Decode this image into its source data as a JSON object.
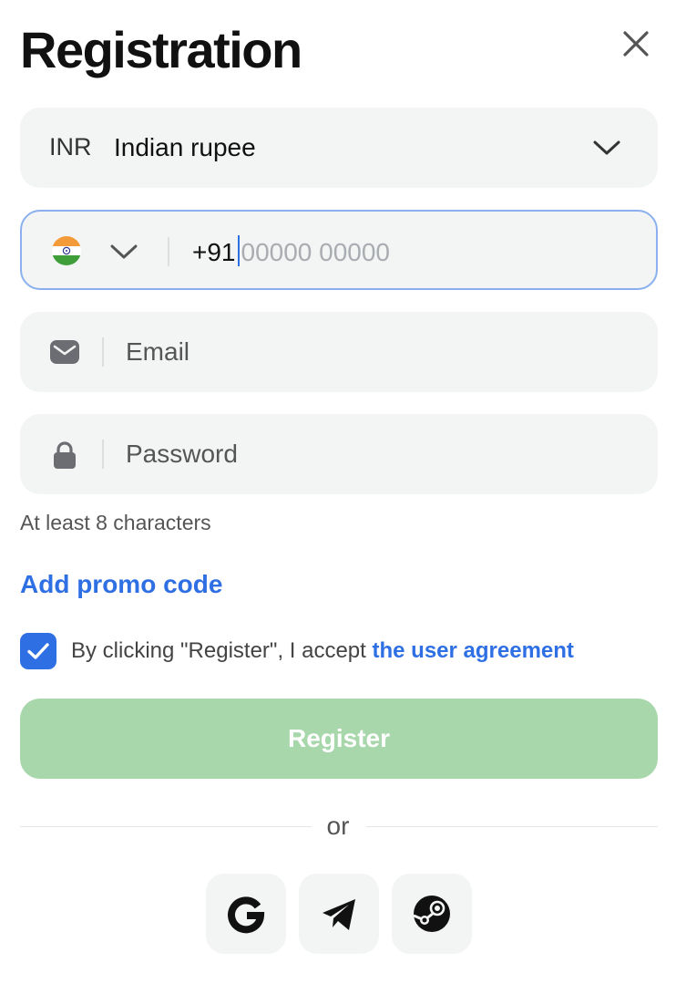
{
  "header": {
    "title": "Registration",
    "close_icon": "close-icon"
  },
  "currency": {
    "code": "INR",
    "name": "Indian rupee",
    "icon": "chevron-down-icon"
  },
  "phone": {
    "flag_icon": "india-flag-icon",
    "prefix": "+91",
    "placeholder": "00000 00000"
  },
  "email": {
    "placeholder": "Email",
    "icon": "mail-icon"
  },
  "password": {
    "placeholder": "Password",
    "icon": "lock-icon",
    "hint": "At least 8 characters"
  },
  "promo": {
    "label": "Add promo code"
  },
  "agreement": {
    "checked": true,
    "text": "By clicking \"Register\", I accept ",
    "link": "the user agreement"
  },
  "register": {
    "label": "Register"
  },
  "divider": {
    "label": "or"
  },
  "social": [
    {
      "icon": "google-icon"
    },
    {
      "icon": "telegram-icon"
    },
    {
      "icon": "steam-icon"
    }
  ],
  "colors": {
    "accent": "#2f6fe4",
    "register_button": "#a7d7aa",
    "field_bg": "#f3f4f4",
    "focus_border": "#8ab1ee"
  }
}
